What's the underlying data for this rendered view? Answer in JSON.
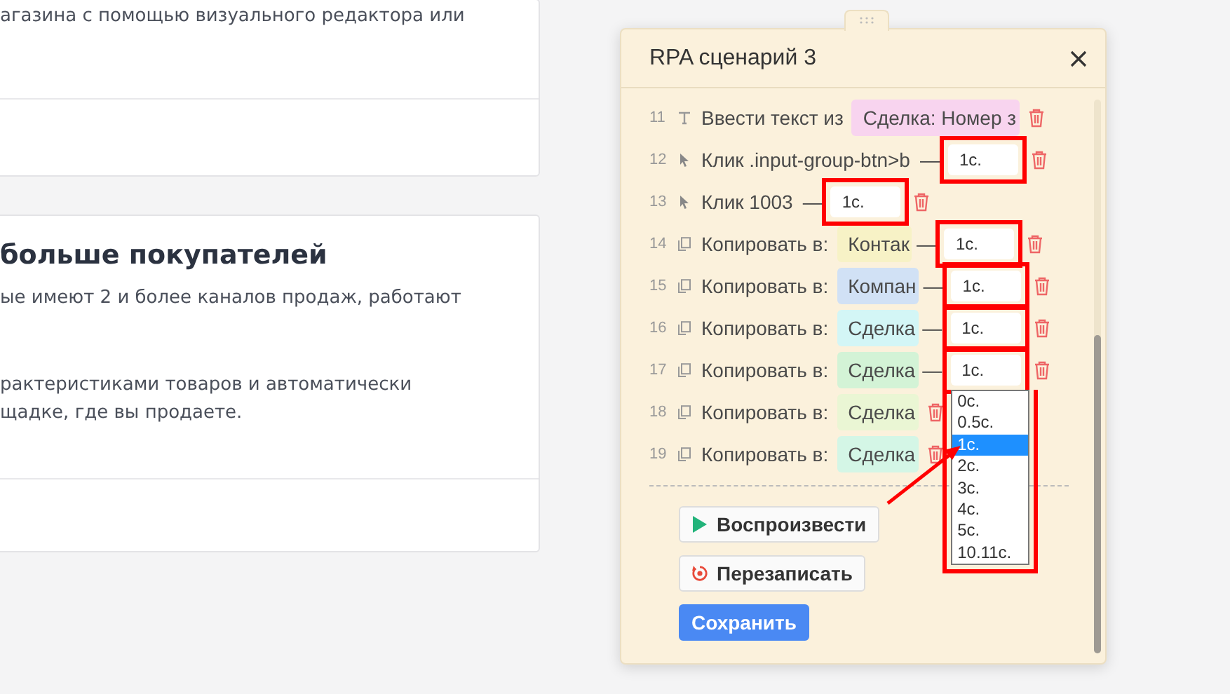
{
  "background_cards": [
    {
      "lines": [
        "агазина с помощью визуального редактора или"
      ]
    },
    {
      "heading": "больше покупателей",
      "lines": [
        "ые имеют 2 и более каналов продаж, работают",
        "рактеристиками товаров и автоматически",
        "щадке, где вы продаете."
      ]
    }
  ],
  "panel": {
    "title": "RPA сценарий 3",
    "steps": [
      {
        "number": "11",
        "kind": "type",
        "label": "Ввести текст из",
        "tag": {
          "text": "Сделка: Номер з",
          "color": "#f8d4ef"
        }
      },
      {
        "number": "12",
        "kind": "click",
        "label": "Клик .input-group-btn>b",
        "dash": "—",
        "delay": {
          "value": "1с.",
          "highlighted": true
        }
      },
      {
        "number": "13",
        "kind": "click",
        "label": "Клик 1003",
        "dash": "—",
        "delay": {
          "value": "1с.",
          "highlighted": true
        }
      },
      {
        "number": "14",
        "kind": "copy",
        "label": "Копировать в:",
        "tag": {
          "text": "Контак",
          "color": "#f7f2c6"
        },
        "dash": "—",
        "delay": {
          "value": "1с.",
          "highlighted": true
        }
      },
      {
        "number": "15",
        "kind": "copy",
        "label": "Копировать в:",
        "tag": {
          "text": "Компан",
          "color": "#d1e1f5"
        },
        "dash": "—",
        "delay": {
          "value": "1с.",
          "highlighted": true
        }
      },
      {
        "number": "16",
        "kind": "copy",
        "label": "Копировать в:",
        "tag": {
          "text": "Сделка",
          "color": "#d3f6f6"
        },
        "dash": "—",
        "delay": {
          "value": "1с.",
          "highlighted": true
        }
      },
      {
        "number": "17",
        "kind": "copy",
        "label": "Копировать в:",
        "tag": {
          "text": "Сделка",
          "color": "#d3f3d6"
        },
        "dash": "—",
        "delay": {
          "value": "1с.",
          "highlighted": true,
          "options": [
            {
              "label": "0с.",
              "selected": false
            },
            {
              "label": "0.5с.",
              "selected": false
            },
            {
              "label": "1с.",
              "selected": true
            },
            {
              "label": "2с.",
              "selected": false
            },
            {
              "label": "3с.",
              "selected": false
            },
            {
              "label": "4с.",
              "selected": false
            },
            {
              "label": "5с.",
              "selected": false
            },
            {
              "label": "10.11с.",
              "selected": false
            }
          ]
        }
      },
      {
        "number": "18",
        "kind": "copy",
        "label": "Копировать в:",
        "tag": {
          "text": "Сделка",
          "color": "#eaf6d4"
        }
      },
      {
        "number": "19",
        "kind": "copy",
        "label": "Копировать в:",
        "tag": {
          "text": "Сделка",
          "color": "#d4f6e6"
        }
      }
    ],
    "buttons": [
      {
        "kind": "play",
        "label": "Воспроизвести"
      },
      {
        "kind": "rerecord",
        "label": "Перезаписать"
      },
      {
        "kind": "save",
        "label": "Сохранить"
      }
    ]
  }
}
